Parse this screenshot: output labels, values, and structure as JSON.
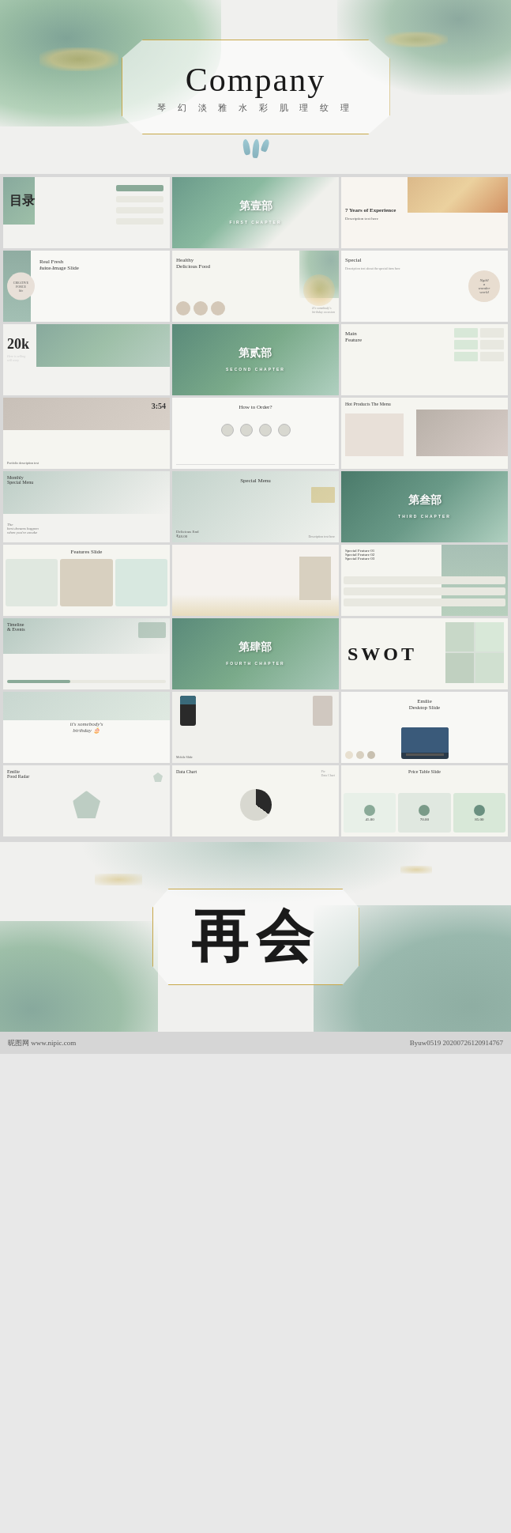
{
  "hero": {
    "title": "Company",
    "subtitle": "琴 幻 淡 雅 水 彩 肌 理 纹 理",
    "polygon_border_color": "#c8a84a"
  },
  "slides": {
    "row1": [
      {
        "id": "toc",
        "label": "目录",
        "type": "toc"
      },
      {
        "id": "chapter1",
        "label": "第壹部",
        "sub": "FIRST CHAPTER",
        "type": "chapter"
      },
      {
        "id": "experience",
        "label": "7 Years of Experience",
        "type": "experience"
      }
    ],
    "row2": [
      {
        "id": "juice",
        "label": "Real Fresh Juice Image Slide",
        "type": "juice"
      },
      {
        "id": "food",
        "label": "Healthy Delicious Food",
        "type": "food"
      },
      {
        "id": "special_r",
        "label": "Special",
        "type": "special_r"
      }
    ],
    "row3": [
      {
        "id": "20k",
        "label": "20k",
        "type": "20k"
      },
      {
        "id": "chapter2",
        "label": "第贰部",
        "sub": "SECOND CHAPTER",
        "type": "chapter"
      },
      {
        "id": "mainfeature",
        "label": "Main Feature",
        "type": "mainfeature"
      }
    ],
    "row4": [
      {
        "id": "portfolio",
        "label": "Portfolio",
        "type": "portfolio"
      },
      {
        "id": "howorder",
        "label": "How to Order?",
        "type": "howorder"
      },
      {
        "id": "hotproducts",
        "label": "Hot Products The Menu",
        "type": "hotproducts"
      }
    ],
    "row5": [
      {
        "id": "specialmenu_l",
        "label": "Monthly Special Menu",
        "type": "specialmenu_l"
      },
      {
        "id": "specialmenu",
        "label": "Special Menu",
        "type": "specialmenu"
      },
      {
        "id": "chapter3",
        "label": "第叁部",
        "sub": "THIRD CHAPTER",
        "type": "chapter3"
      }
    ],
    "row6": [
      {
        "id": "featuresslide",
        "label": "Features Slide",
        "type": "featuresslide"
      },
      {
        "id": "features_blank",
        "label": "",
        "type": "features_blank"
      },
      {
        "id": "specialfeature",
        "label": "Special Feature",
        "type": "specialfeature"
      }
    ],
    "row7": [
      {
        "id": "timeline",
        "label": "Timeline & Events",
        "type": "timeline"
      },
      {
        "id": "chapter4",
        "label": "第肆部",
        "sub": "FOURTH CHAPTER",
        "type": "chapter4"
      },
      {
        "id": "swot",
        "label": "SWOT",
        "type": "swot"
      }
    ],
    "row8": [
      {
        "id": "birthday",
        "label": "it's somebody's birthday",
        "type": "birthday"
      },
      {
        "id": "mobile",
        "label": "Mobile Slide",
        "type": "mobile"
      },
      {
        "id": "desktop",
        "label": "Emilie Desktop Slide",
        "type": "desktop"
      }
    ],
    "row9": [
      {
        "id": "foodradar",
        "label": "Emilie Food Radar",
        "type": "foodradar"
      },
      {
        "id": "datachart",
        "label": "Data Chart",
        "type": "datachart"
      },
      {
        "id": "pricetable",
        "label": "Price Table Slide",
        "type": "pricetable"
      }
    ]
  },
  "price_items": [
    {
      "label": "45.00"
    },
    {
      "label": "70.00"
    },
    {
      "label": "85.00"
    }
  ],
  "ending": {
    "title": "再会"
  },
  "watermarks": {
    "left": "昵图网 www.nipic.com",
    "right": "Byuw0519 20200726120914767"
  }
}
